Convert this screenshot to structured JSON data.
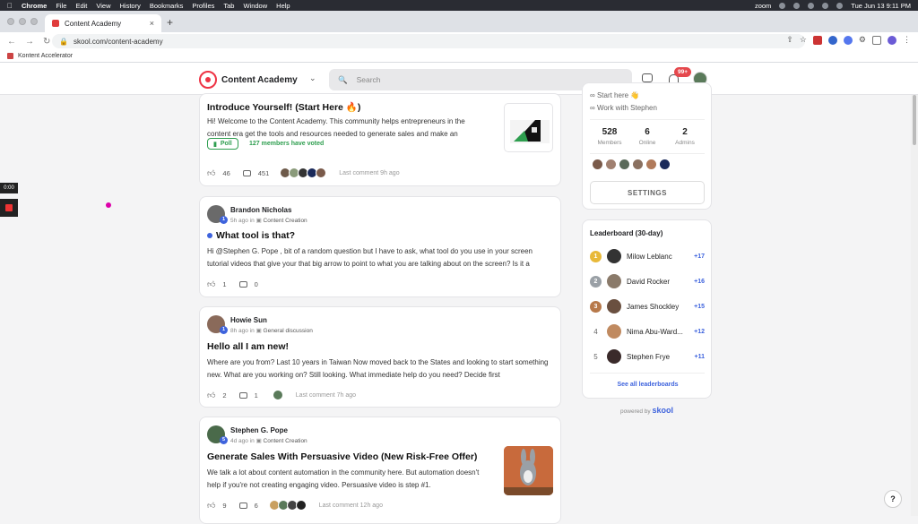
{
  "menubar": {
    "app": "Chrome",
    "items": [
      "File",
      "Edit",
      "View",
      "History",
      "Bookmarks",
      "Profiles",
      "Tab",
      "Window",
      "Help"
    ],
    "zoom": "zoom",
    "datetime": "Tue Jun 13  9:11 PM"
  },
  "browser": {
    "tab_title": "Content Academy",
    "url": "skool.com/content-academy",
    "bookmark": "Kontent Accelerator"
  },
  "header": {
    "community_name": "Content Academy",
    "search_placeholder": "Search",
    "notif_badge": "99+"
  },
  "posts": [
    {
      "title": "Introduce Yourself! (Start Here 🔥)",
      "body": "Hi! Welcome to the Content Academy. This community helps entrepreneurs in the content era get the tools and resources needed to generate sales and make an",
      "poll_label": "Poll",
      "voted": "127 members have voted",
      "likes": "46",
      "comments": "451",
      "last_comment": "Last comment 9h ago"
    },
    {
      "author": "Brandon Nicholas",
      "level": "1",
      "time": "5h ago in",
      "category": "Content Creation",
      "title": "What tool is that?",
      "body": "Hi @Stephen G. Pope , bit of a random question but I have to ask, what tool do you use in your screen tutorial videos that give your that big arrow to point to what you are talking about on the screen? Is it a",
      "likes": "1",
      "comments": "0"
    },
    {
      "author": "Howie Sun",
      "level": "1",
      "time": "8h ago in",
      "category": "General discussion",
      "title": "Hello all I am new!",
      "body": "Where are you from? Last 10 years in Taiwan Now moved back to the States and looking to start something new. What are you working on? Still looking. What immediate help do you need? Decide first",
      "likes": "2",
      "comments": "1",
      "last_comment": "Last comment 7h ago"
    },
    {
      "author": "Stephen G. Pope",
      "level": "5",
      "time": "4d ago in",
      "category": "Content Creation",
      "title": "Generate Sales With Persuasive Video (New Risk-Free Offer)",
      "body": "We talk a lot about content automation in the community here. But automation doesn't help if you're not creating engaging video. Persuasive video is step #1.",
      "likes": "9",
      "comments": "6",
      "last_comment": "Last comment 12h ago"
    }
  ],
  "about": {
    "links": [
      "Start here 👋",
      "Work with Stephen"
    ],
    "stats": [
      {
        "value": "528",
        "label": "Members"
      },
      {
        "value": "6",
        "label": "Online"
      },
      {
        "value": "2",
        "label": "Admins"
      }
    ],
    "settings_label": "SETTINGS"
  },
  "leaderboard": {
    "title": "Leaderboard (30-day)",
    "rows": [
      {
        "rank": "1",
        "name": "Milow Leblanc",
        "points": "+17"
      },
      {
        "rank": "2",
        "name": "David Rocker",
        "points": "+16"
      },
      {
        "rank": "3",
        "name": "James Shockley",
        "points": "+15"
      },
      {
        "rank": "4",
        "name": "Nima Abu-Ward...",
        "points": "+12"
      },
      {
        "rank": "5",
        "name": "Stephen Frye",
        "points": "+11"
      }
    ],
    "see_all": "See all leaderboards"
  },
  "powered_by": "powered by",
  "brand": "skool",
  "recorder_time": "0:00",
  "help": "?",
  "colors": {
    "accent": "#3e63dd",
    "poll_green": "#2e9e4f",
    "badge_red": "#e5484d"
  }
}
